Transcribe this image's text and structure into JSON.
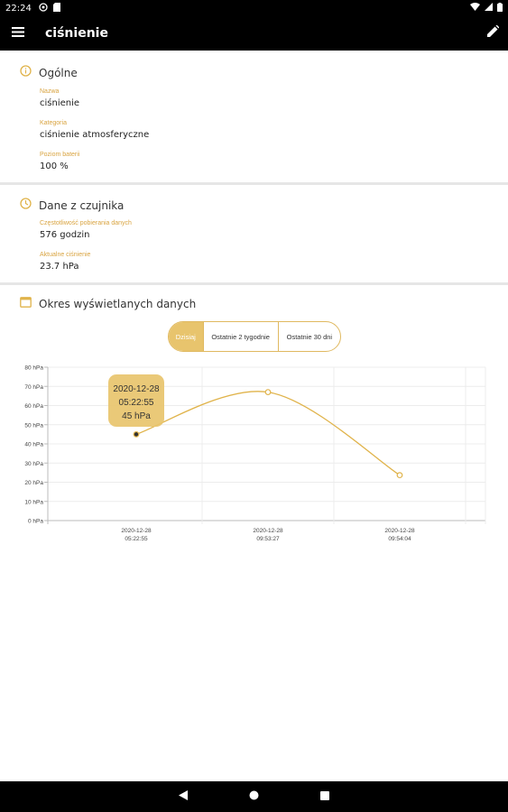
{
  "status_bar": {
    "time": "22:24"
  },
  "app_bar": {
    "title": "ciśnienie"
  },
  "general": {
    "title": "Ogólne",
    "name_label": "Nazwa",
    "name_value": "ciśnienie",
    "category_label": "Kategoria",
    "category_value": "ciśnienie atmosferyczne",
    "battery_label": "Poziom baterii",
    "battery_value": "100 %"
  },
  "sensor": {
    "title": "Dane z czujnika",
    "frequency_label": "Częstotliwość pobierania danych",
    "frequency_value": "576 godzin",
    "pressure_label": "Aktualne ciśnienie",
    "pressure_value": "23.7 hPa"
  },
  "range": {
    "title": "Okres wyświetlanych danych",
    "options": [
      "Dzisiaj",
      "Ostatnie 2 tygodnie",
      "Ostatnie 30 dni"
    ],
    "selected": "Dzisiaj"
  },
  "tooltip": {
    "date": "2020-12-28",
    "time": "05:22:55",
    "value": "45 hPa"
  },
  "colors": {
    "accent": "#e8c46d",
    "line": "#e0b34a",
    "label": "#d9a441"
  },
  "chart_data": {
    "type": "line",
    "x": [
      "2020-12-28 05:22:55",
      "2020-12-28 09:53:27",
      "2020-12-28 09:54:04"
    ],
    "x_tick_labels": [
      [
        "2020-12-28",
        "05:22:55"
      ],
      [
        "2020-12-28",
        "09:53:27"
      ],
      [
        "2020-12-28",
        "09:54:04"
      ]
    ],
    "y_ticks": [
      "0 hPa",
      "10 hPa",
      "20 hPa",
      "30 hPa",
      "40 hPa",
      "50 hPa",
      "60 hPa",
      "70 hPa",
      "80 hPa"
    ],
    "series": [
      {
        "values": [
          45,
          67,
          23.7
        ]
      }
    ],
    "ylim": [
      0,
      80
    ],
    "grid": true
  }
}
